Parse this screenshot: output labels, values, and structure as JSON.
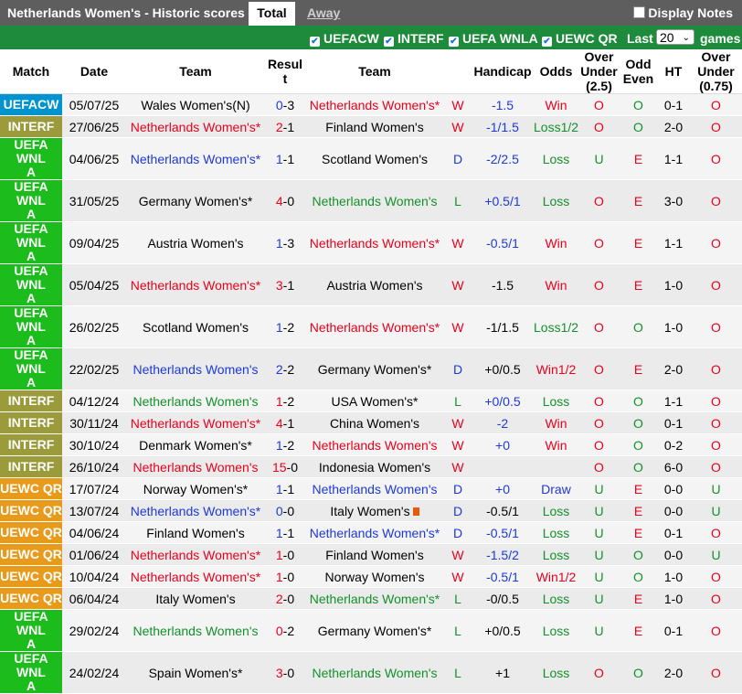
{
  "header": {
    "title": "Netherlands Women's - Historic scores",
    "tab_total": "Total",
    "tab_away": "Away",
    "notes_label": "Display Notes"
  },
  "filters": {
    "items": [
      "UEFACW",
      "INTERF",
      "UEFA WNLA",
      "UEWC QR"
    ],
    "last_label": "Last",
    "last_value": "20",
    "games_label": "games"
  },
  "columns": [
    "Match",
    "Date",
    "Team",
    "Resul\nt",
    "Team",
    "Handicap",
    "Odds",
    "Over\nUnder\n(2.5)",
    "Odd\nEven",
    "HT",
    "Over\nUnder\n(0.75)"
  ],
  "colors": {
    "uefacw": "#0093d0",
    "interf": "#9b9b3b",
    "wnla": "#1cbc1c",
    "uewc": "#e89a1a",
    "red": "#e8001c",
    "green": "#13902a",
    "blue": "#1d39d8",
    "orange": "#e88a00"
  },
  "rows": [
    {
      "comp": "UEFACW",
      "cc": "uefacw",
      "date": "05/07/25",
      "home": "Wales Women's(N)",
      "hc": "",
      "score_h": "0",
      "score_a": "3",
      "sc": "blu",
      "away": "Netherlands Women's*",
      "ac": "red",
      "res": "W",
      "rc": "red",
      "hcap": "-1.5",
      "hcc": "blu",
      "odds": "Win",
      "oc": "red",
      "ou": "O",
      "ouc": "red",
      "oe": "O",
      "oec": "grn",
      "ht": "0-1",
      "ou2": "O",
      "ou2c": "red",
      "tall": false
    },
    {
      "comp": "INTERF",
      "cc": "interf",
      "date": "27/06/25",
      "home": "Netherlands Women's*",
      "hc": "red",
      "score_h": "2",
      "score_a": "1",
      "sc": "red",
      "away": "Finland Women's",
      "ac": "",
      "res": "W",
      "rc": "red",
      "hcap": "-1/1.5",
      "hcc": "blu",
      "odds": "Loss1/2",
      "oc": "grn",
      "ou": "O",
      "ouc": "red",
      "oe": "O",
      "oec": "grn",
      "ht": "2-0",
      "ou2": "O",
      "ou2c": "red",
      "tall": false
    },
    {
      "comp": "UEFA WNL\nA",
      "cc": "wnla",
      "date": "04/06/25",
      "home": "Netherlands Women's*",
      "hc": "blu",
      "score_h": "1",
      "score_a": "1",
      "sc": "blu",
      "away": "Scotland Women's",
      "ac": "",
      "res": "D",
      "rc": "blu",
      "hcap": "-2/2.5",
      "hcc": "blu",
      "odds": "Loss",
      "oc": "grn",
      "ou": "U",
      "ouc": "grn",
      "oe": "E",
      "oec": "red",
      "ht": "1-1",
      "ou2": "O",
      "ou2c": "red",
      "tall": true
    },
    {
      "comp": "UEFA WNL\nA",
      "cc": "wnla",
      "date": "31/05/25",
      "home": "Germany Women's*",
      "hc": "",
      "score_h": "4",
      "score_a": "0",
      "sc": "red",
      "away": "Netherlands Women's",
      "ac": "grn",
      "res": "L",
      "rc": "grn",
      "hcap": "+0.5/1",
      "hcc": "blu",
      "odds": "Loss",
      "oc": "grn",
      "ou": "O",
      "ouc": "red",
      "oe": "E",
      "oec": "red",
      "ht": "3-0",
      "ou2": "O",
      "ou2c": "red",
      "tall": true
    },
    {
      "comp": "UEFA WNL\nA",
      "cc": "wnla",
      "date": "09/04/25",
      "home": "Austria Women's",
      "hc": "",
      "score_h": "1",
      "score_a": "3",
      "sc": "blu",
      "away": "Netherlands Women's*",
      "ac": "red",
      "res": "W",
      "rc": "red",
      "hcap": "-0.5/1",
      "hcc": "blu",
      "odds": "Win",
      "oc": "red",
      "ou": "O",
      "ouc": "red",
      "oe": "E",
      "oec": "red",
      "ht": "1-1",
      "ou2": "O",
      "ou2c": "red",
      "tall": true
    },
    {
      "comp": "UEFA WNL\nA",
      "cc": "wnla",
      "date": "05/04/25",
      "home": "Netherlands Women's*",
      "hc": "red",
      "score_h": "3",
      "score_a": "1",
      "sc": "red",
      "away": "Austria Women's",
      "ac": "",
      "res": "W",
      "rc": "red",
      "hcap": "-1.5",
      "hcc": "",
      "odds": "Win",
      "oc": "red",
      "ou": "O",
      "ouc": "red",
      "oe": "E",
      "oec": "red",
      "ht": "1-0",
      "ou2": "O",
      "ou2c": "red",
      "tall": true
    },
    {
      "comp": "UEFA WNL\nA",
      "cc": "wnla",
      "date": "26/02/25",
      "home": "Scotland Women's",
      "hc": "",
      "score_h": "1",
      "score_a": "2",
      "sc": "blu",
      "away": "Netherlands Women's*",
      "ac": "red",
      "res": "W",
      "rc": "red",
      "hcap": "-1/1.5",
      "hcc": "",
      "odds": "Loss1/2",
      "oc": "grn",
      "ou": "O",
      "ouc": "red",
      "oe": "O",
      "oec": "grn",
      "ht": "1-0",
      "ou2": "O",
      "ou2c": "red",
      "tall": true
    },
    {
      "comp": "UEFA WNL\nA",
      "cc": "wnla",
      "date": "22/02/25",
      "home": "Netherlands Women's",
      "hc": "blu",
      "score_h": "2",
      "score_a": "2",
      "sc": "blu",
      "away": "Germany Women's*",
      "ac": "",
      "res": "D",
      "rc": "blu",
      "hcap": "+0/0.5",
      "hcc": "",
      "odds": "Win1/2",
      "oc": "red",
      "ou": "O",
      "ouc": "red",
      "oe": "E",
      "oec": "red",
      "ht": "2-0",
      "ou2": "O",
      "ou2c": "red",
      "tall": true
    },
    {
      "comp": "INTERF",
      "cc": "interf",
      "date": "04/12/24",
      "home": "Netherlands Women's",
      "hc": "grn",
      "score_h": "1",
      "score_a": "2",
      "sc": "red",
      "away": "USA Women's*",
      "ac": "",
      "res": "L",
      "rc": "grn",
      "hcap": "+0/0.5",
      "hcc": "blu",
      "odds": "Loss",
      "oc": "grn",
      "ou": "O",
      "ouc": "red",
      "oe": "O",
      "oec": "grn",
      "ht": "1-1",
      "ou2": "O",
      "ou2c": "red",
      "tall": false
    },
    {
      "comp": "INTERF",
      "cc": "interf",
      "date": "30/11/24",
      "home": "Netherlands Women's*",
      "hc": "red",
      "score_h": "4",
      "score_a": "1",
      "sc": "red",
      "away": "China Women's",
      "ac": "",
      "res": "W",
      "rc": "red",
      "hcap": "-2",
      "hcc": "blu",
      "odds": "Win",
      "oc": "red",
      "ou": "O",
      "ouc": "red",
      "oe": "O",
      "oec": "grn",
      "ht": "0-1",
      "ou2": "O",
      "ou2c": "red",
      "tall": false
    },
    {
      "comp": "INTERF",
      "cc": "interf",
      "date": "30/10/24",
      "home": "Denmark Women's*",
      "hc": "",
      "score_h": "1",
      "score_a": "2",
      "sc": "blu",
      "away": "Netherlands Women's",
      "ac": "red",
      "res": "W",
      "rc": "red",
      "hcap": "+0",
      "hcc": "blu",
      "odds": "Win",
      "oc": "red",
      "ou": "O",
      "ouc": "red",
      "oe": "O",
      "oec": "grn",
      "ht": "0-2",
      "ou2": "O",
      "ou2c": "red",
      "tall": false
    },
    {
      "comp": "INTERF",
      "cc": "interf",
      "date": "26/10/24",
      "home": "Netherlands Women's",
      "hc": "red",
      "score_h": "15",
      "score_a": "0",
      "sc": "red",
      "away": "Indonesia Women's",
      "ac": "",
      "res": "W",
      "rc": "red",
      "hcap": "",
      "hcc": "",
      "odds": "",
      "oc": "",
      "ou": "O",
      "ouc": "red",
      "oe": "O",
      "oec": "grn",
      "ht": "6-0",
      "ou2": "O",
      "ou2c": "red",
      "tall": false
    },
    {
      "comp": "UEWC QR",
      "cc": "uewc",
      "date": "17/07/24",
      "home": "Norway Women's*",
      "hc": "",
      "score_h": "1",
      "score_a": "1",
      "sc": "blu",
      "away": "Netherlands Women's",
      "ac": "blu",
      "res": "D",
      "rc": "blu",
      "hcap": "+0",
      "hcc": "blu",
      "odds": "Draw",
      "oc": "blu",
      "ou": "U",
      "ouc": "grn",
      "oe": "E",
      "oec": "red",
      "ht": "0-0",
      "ou2": "U",
      "ou2c": "grn",
      "tall": false
    },
    {
      "comp": "UEWC QR",
      "cc": "uewc",
      "date": "13/07/24",
      "home": "Netherlands Women's*",
      "hc": "blu",
      "score_h": "0",
      "score_a": "0",
      "sc": "blu",
      "away": "Italy Women's",
      "ac": "",
      "flag": true,
      "res": "D",
      "rc": "blu",
      "hcap": "-0.5/1",
      "hcc": "",
      "odds": "Loss",
      "oc": "grn",
      "ou": "U",
      "ouc": "grn",
      "oe": "E",
      "oec": "red",
      "ht": "0-0",
      "ou2": "U",
      "ou2c": "grn",
      "tall": false
    },
    {
      "comp": "UEWC QR",
      "cc": "uewc",
      "date": "04/06/24",
      "home": "Finland Women's",
      "hc": "",
      "score_h": "1",
      "score_a": "1",
      "sc": "blu",
      "away": "Netherlands Women's*",
      "ac": "blu",
      "res": "D",
      "rc": "blu",
      "hcap": "-0.5/1",
      "hcc": "blu",
      "odds": "Loss",
      "oc": "grn",
      "ou": "U",
      "ouc": "grn",
      "oe": "E",
      "oec": "red",
      "ht": "0-1",
      "ou2": "O",
      "ou2c": "red",
      "tall": false
    },
    {
      "comp": "UEWC QR",
      "cc": "uewc",
      "date": "01/06/24",
      "home": "Netherlands Women's*",
      "hc": "red",
      "score_h": "1",
      "score_a": "0",
      "sc": "red",
      "away": "Finland Women's",
      "ac": "",
      "res": "W",
      "rc": "red",
      "hcap": "-1.5/2",
      "hcc": "blu",
      "odds": "Loss",
      "oc": "grn",
      "ou": "U",
      "ouc": "grn",
      "oe": "O",
      "oec": "grn",
      "ht": "0-0",
      "ou2": "U",
      "ou2c": "grn",
      "tall": false
    },
    {
      "comp": "UEWC QR",
      "cc": "uewc",
      "date": "10/04/24",
      "home": "Netherlands Women's*",
      "hc": "red",
      "score_h": "1",
      "score_a": "0",
      "sc": "red",
      "away": "Norway Women's",
      "ac": "",
      "res": "W",
      "rc": "red",
      "hcap": "-0.5/1",
      "hcc": "blu",
      "odds": "Win1/2",
      "oc": "red",
      "ou": "U",
      "ouc": "grn",
      "oe": "O",
      "oec": "grn",
      "ht": "1-0",
      "ou2": "O",
      "ou2c": "red",
      "tall": false
    },
    {
      "comp": "UEWC QR",
      "cc": "uewc",
      "date": "06/04/24",
      "home": "Italy Women's",
      "hc": "",
      "score_h": "2",
      "score_a": "0",
      "sc": "red",
      "away": "Netherlands Women's*",
      "ac": "grn",
      "res": "L",
      "rc": "grn",
      "hcap": "-0/0.5",
      "hcc": "",
      "odds": "Loss",
      "oc": "grn",
      "ou": "U",
      "ouc": "grn",
      "oe": "E",
      "oec": "red",
      "ht": "1-0",
      "ou2": "O",
      "ou2c": "red",
      "tall": false
    },
    {
      "comp": "UEFA WNL\nA",
      "cc": "wnla",
      "date": "29/02/24",
      "home": "Netherlands Women's",
      "hc": "grn",
      "score_h": "0",
      "score_a": "2",
      "sc": "red",
      "away": "Germany Women's*",
      "ac": "",
      "res": "L",
      "rc": "grn",
      "hcap": "+0/0.5",
      "hcc": "",
      "odds": "Loss",
      "oc": "grn",
      "ou": "U",
      "ouc": "grn",
      "oe": "E",
      "oec": "red",
      "ht": "0-1",
      "ou2": "O",
      "ou2c": "red",
      "tall": true
    },
    {
      "comp": "UEFA WNL\nA",
      "cc": "wnla",
      "date": "24/02/24",
      "home": "Spain Women's*",
      "hc": "",
      "score_h": "3",
      "score_a": "0",
      "sc": "red",
      "away": "Netherlands Women's",
      "ac": "grn",
      "res": "L",
      "rc": "grn",
      "hcap": "+1",
      "hcc": "",
      "odds": "Loss",
      "oc": "grn",
      "ou": "O",
      "ouc": "red",
      "oe": "O",
      "oec": "grn",
      "ht": "2-0",
      "ou2": "O",
      "ou2c": "red",
      "tall": true
    }
  ]
}
